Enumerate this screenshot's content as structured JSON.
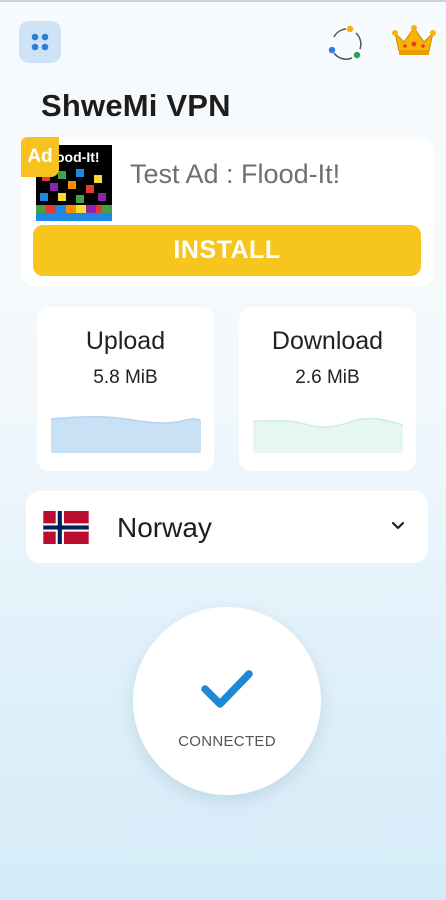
{
  "app": {
    "title": "ShweMi VPN"
  },
  "header": {
    "menu_icon": "apps-grid-icon",
    "loader_icon": "circular-dots-icon",
    "premium_icon": "crown-icon"
  },
  "ad": {
    "badge": "Ad",
    "thumb_title": "ood-It!",
    "title": "Test Ad : Flood-It!",
    "install_label": "INSTALL"
  },
  "stats": {
    "upload": {
      "label": "Upload",
      "value": "5.8 MiB"
    },
    "download": {
      "label": "Download",
      "value": "2.6 MiB"
    }
  },
  "server": {
    "country": "Norway",
    "flag_icon": "norway-flag-icon"
  },
  "connection": {
    "status": "CONNECTED"
  },
  "colors": {
    "accent_yellow": "#f6c51e",
    "check_blue": "#1e88d6",
    "upload_fill": "#c9e1f5",
    "download_fill": "#e6f7f1"
  }
}
